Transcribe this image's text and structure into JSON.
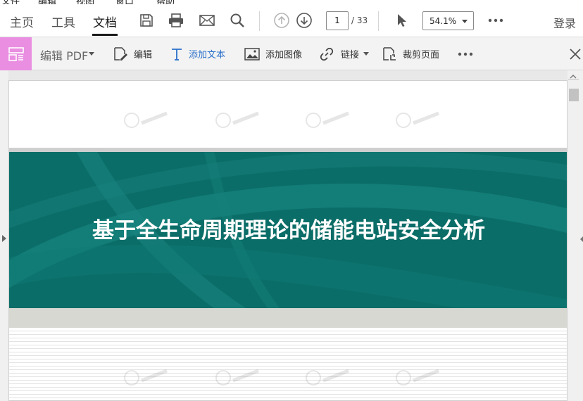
{
  "menu_bar": {
    "items": [
      "文件",
      "编辑",
      "视图",
      "窗口",
      "帮助"
    ]
  },
  "nav": {
    "tabs": [
      {
        "label": "主页",
        "active": false
      },
      {
        "label": "工具",
        "active": false
      },
      {
        "label": "文档",
        "active": true
      }
    ],
    "icons": [
      "save-icon",
      "print-icon",
      "mail-icon",
      "search-icon",
      "page-up-icon",
      "page-down-icon",
      "select-cursor-icon",
      "more-icon"
    ],
    "page_current": "1",
    "page_total": "/ 33",
    "zoom": "54.1%",
    "login_label": "登录"
  },
  "edit_toolbar": {
    "title": "编辑 PDF",
    "tools": [
      {
        "label": "编辑",
        "icon": "edit-icon",
        "has_caret": false
      },
      {
        "label": "添加文本",
        "icon": "add-text-icon",
        "has_caret": false
      },
      {
        "label": "添加图像",
        "icon": "add-image-icon",
        "has_caret": false
      },
      {
        "label": "链接",
        "icon": "link-icon",
        "has_caret": true
      },
      {
        "label": "裁剪页面",
        "icon": "crop-page-icon",
        "has_caret": false
      }
    ],
    "accent": "#e98ee0"
  },
  "document": {
    "title": "基于全生命周期理论的储能电站安全分析",
    "banner_color": "#0b6d68"
  }
}
